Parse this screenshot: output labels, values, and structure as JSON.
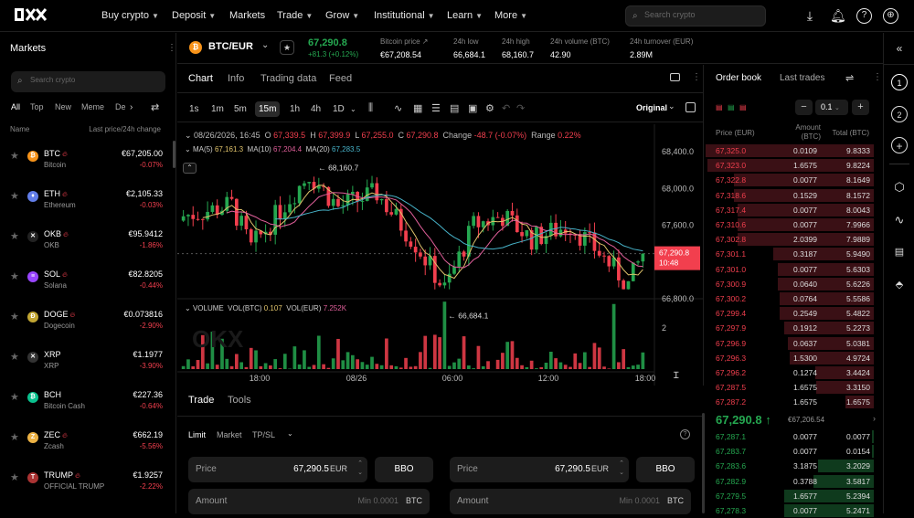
{
  "nav": {
    "items": [
      {
        "label": "Buy crypto",
        "dropdown": true
      },
      {
        "label": "Deposit",
        "dropdown": true
      },
      {
        "label": "Markets",
        "dropdown": false
      },
      {
        "label": "Trade",
        "dropdown": true
      },
      {
        "label": "Grow",
        "dropdown": true
      },
      {
        "label": "Institutional",
        "dropdown": true
      },
      {
        "label": "Learn",
        "dropdown": true
      },
      {
        "label": "More",
        "dropdown": true
      }
    ],
    "search_placeholder": "Search crypto"
  },
  "markets": {
    "title": "Markets",
    "search_placeholder": "Search crypto",
    "tabs": [
      "All",
      "Top",
      "New",
      "Meme",
      "De"
    ],
    "col_name": "Name",
    "col_price": "Last price/24h change",
    "coins": [
      {
        "sym": "BTC",
        "name": "Bitcoin",
        "price": "€67,205.00",
        "change": "-0.07%",
        "color": "#f7931a",
        "glyph": "₿",
        "hot": true
      },
      {
        "sym": "ETH",
        "name": "Ethereum",
        "price": "€2,105.33",
        "change": "-0.03%",
        "color": "#627eea",
        "glyph": "♦",
        "hot": true
      },
      {
        "sym": "OKB",
        "name": "OKB",
        "price": "€95.9412",
        "change": "-1.86%",
        "color": "#222",
        "glyph": "✕",
        "hot": true
      },
      {
        "sym": "SOL",
        "name": "Solana",
        "price": "€82.8205",
        "change": "-0.44%",
        "color": "#9945ff",
        "glyph": "≡",
        "hot": true
      },
      {
        "sym": "DOGE",
        "name": "Dogecoin",
        "price": "€0.073816",
        "change": "-2.90%",
        "color": "#c2a633",
        "glyph": "Ð",
        "hot": true
      },
      {
        "sym": "XRP",
        "name": "XRP",
        "price": "€1.1977",
        "change": "-3.90%",
        "color": "#333",
        "glyph": "✕",
        "hot": false
      },
      {
        "sym": "BCH",
        "name": "Bitcoin Cash",
        "price": "€227.36",
        "change": "-0.64%",
        "color": "#0ac18e",
        "glyph": "₿",
        "hot": false
      },
      {
        "sym": "ZEC",
        "name": "Zcash",
        "price": "€662.19",
        "change": "-5.56%",
        "color": "#ecb244",
        "glyph": "Z",
        "hot": true
      },
      {
        "sym": "TRUMP",
        "name": "OFFICIAL TRUMP",
        "price": "€1.9257",
        "change": "-2.22%",
        "color": "#a33",
        "glyph": "T",
        "hot": true
      }
    ]
  },
  "pair": {
    "name": "BTC/EUR",
    "last": "67,290.8",
    "change": "+81.3 (+0.12%)",
    "stats": [
      {
        "label": "Bitcoin price ↗",
        "value": "€67,208.54"
      },
      {
        "label": "24h low",
        "value": "66,684.1"
      },
      {
        "label": "24h high",
        "value": "68,160.7"
      },
      {
        "label": "24h volume (BTC)",
        "value": "42.90"
      },
      {
        "label": "24h turnover (EUR)",
        "value": "2.89M"
      }
    ]
  },
  "chart": {
    "tabs": [
      "Chart",
      "Info",
      "Trading data",
      "Feed"
    ],
    "timeframes": [
      "1s",
      "1m",
      "5m",
      "15m",
      "1h",
      "4h",
      "1D"
    ],
    "active_tf": "15m",
    "view": "Original",
    "ohlc": {
      "date": "08/26/2026, 16:45",
      "o": "67,339.5",
      "h": "67,399.9",
      "l": "67,255.0",
      "c": "67,290.8",
      "change": "-48.7 (-0.07%)",
      "range": "0.22%"
    },
    "ma": {
      "ma5": "67,161.3",
      "ma10": "67,204.4",
      "ma20": "67,283.5"
    },
    "volume": {
      "label": "VOLUME",
      "vol_btc": "0.107",
      "vol_eur": "7.252K"
    },
    "hi_label": "68,160.7",
    "lo_label": "66,684.1",
    "price_tag": "67,290.8",
    "price_tag_time": "10:48",
    "y_ticks": [
      "68,800.0",
      "68,400.0",
      "68,000.0",
      "67,600.0",
      "67,200.0",
      "66,800.0"
    ],
    "vol_tick": "2",
    "x_ticks": [
      "18:00",
      "08/26",
      "06:00",
      "12:00",
      "18:00"
    ]
  },
  "trade": {
    "tabs": [
      "Trade",
      "Tools"
    ],
    "order_types": [
      "Limit",
      "Market",
      "TP/SL"
    ],
    "price_label": "Price",
    "price_value": "67,290.5",
    "currency": "EUR",
    "bbo": "BBO",
    "amount_label": "Amount",
    "amount_min": "Min 0.0001",
    "amount_unit": "BTC"
  },
  "orderbook": {
    "tabs": [
      "Order book",
      "Last trades"
    ],
    "tick": "0.1",
    "col_price": "Price (EUR)",
    "col_amount": "Amount (BTC)",
    "col_total": "Total (BTC)",
    "asks": [
      {
        "p": "67,325.0",
        "a": "0.0109",
        "t": "9.8333",
        "w": 1.0
      },
      {
        "p": "67,323.0",
        "a": "1.6575",
        "t": "9.8224",
        "w": 0.99
      },
      {
        "p": "67,322.8",
        "a": "0.0077",
        "t": "8.1649",
        "w": 0.83
      },
      {
        "p": "67,318.6",
        "a": "0.1529",
        "t": "8.1572",
        "w": 0.83
      },
      {
        "p": "67,317.4",
        "a": "0.0077",
        "t": "8.0043",
        "w": 0.81
      },
      {
        "p": "67,310.6",
        "a": "0.0077",
        "t": "7.9966",
        "w": 0.81
      },
      {
        "p": "67,302.8",
        "a": "2.0399",
        "t": "7.9889",
        "w": 0.81
      },
      {
        "p": "67,301.1",
        "a": "0.3187",
        "t": "5.9490",
        "w": 0.6
      },
      {
        "p": "67,301.0",
        "a": "0.0077",
        "t": "5.6303",
        "w": 0.57
      },
      {
        "p": "67,300.9",
        "a": "0.0640",
        "t": "5.6226",
        "w": 0.57
      },
      {
        "p": "67,300.2",
        "a": "0.0764",
        "t": "5.5586",
        "w": 0.56
      },
      {
        "p": "67,299.4",
        "a": "0.2549",
        "t": "5.4822",
        "w": 0.56
      },
      {
        "p": "67,297.9",
        "a": "0.1912",
        "t": "5.2273",
        "w": 0.53
      },
      {
        "p": "67,296.9",
        "a": "0.0637",
        "t": "5.0381",
        "w": 0.51
      },
      {
        "p": "67,296.3",
        "a": "1.5300",
        "t": "4.9724",
        "w": 0.5
      },
      {
        "p": "67,296.2",
        "a": "0.1274",
        "t": "3.4424",
        "w": 0.35
      },
      {
        "p": "67,287.5",
        "a": "1.6575",
        "t": "3.3150",
        "w": 0.34
      },
      {
        "p": "67,287.2",
        "a": "1.6575",
        "t": "1.6575",
        "w": 0.17
      }
    ],
    "mid": "67,290.8 ↑",
    "mid_sub": "€67,206.54",
    "bids": [
      {
        "p": "67,287.1",
        "a": "0.0077",
        "t": "0.0077",
        "w": 0.01
      },
      {
        "p": "67,283.7",
        "a": "0.0077",
        "t": "0.0154",
        "w": 0.01
      },
      {
        "p": "67,283.6",
        "a": "3.1875",
        "t": "3.2029",
        "w": 0.33
      },
      {
        "p": "67,282.9",
        "a": "0.3788",
        "t": "3.5817",
        "w": 0.36
      },
      {
        "p": "67,279.5",
        "a": "1.6577",
        "t": "5.2394",
        "w": 0.53
      },
      {
        "p": "67,278.3",
        "a": "0.0077",
        "t": "5.2471",
        "w": 0.53
      }
    ]
  },
  "colors": {
    "up": "#25a750",
    "down": "#f23f4e",
    "ma5": "#e0c36b",
    "ma10": "#e05f9a",
    "ma20": "#47b3c9"
  }
}
